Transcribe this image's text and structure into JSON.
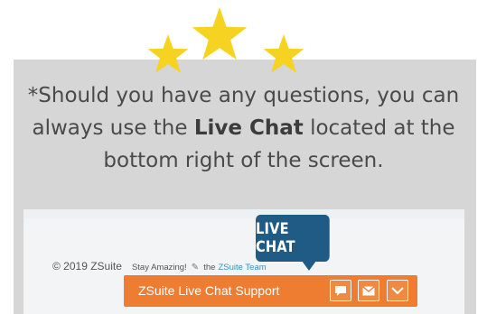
{
  "message": {
    "before_bold": "*Should you have any questions, you can",
    "line2_before": "always use the ",
    "bold": "Live Chat",
    "line2_after": " located at the",
    "line3": "bottom right of the screen."
  },
  "footer": {
    "copyright": "© 2019 ZSuite",
    "tagline": "Stay Amazing!",
    "by": "the",
    "team_link": "ZSuite Team"
  },
  "bubble": {
    "label": "LIVE CHAT"
  },
  "chat_bar": {
    "title": "ZSuite Live Chat Support",
    "buttons": [
      {
        "icon": "chat-icon"
      },
      {
        "icon": "envelope-icon"
      },
      {
        "icon": "chevron-down-icon"
      }
    ]
  },
  "colors": {
    "star": "#f7d321",
    "panel": "#d6d6d6",
    "bubble": "#1f5b85",
    "chat_bar": "#ee7d31"
  }
}
